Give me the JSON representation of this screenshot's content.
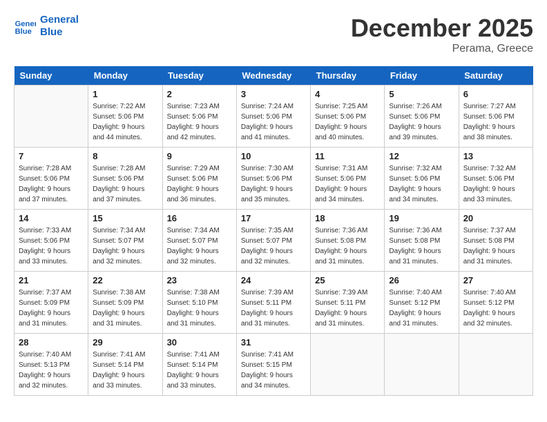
{
  "header": {
    "logo_line1": "General",
    "logo_line2": "Blue",
    "month": "December 2025",
    "location": "Perama, Greece"
  },
  "days_of_week": [
    "Sunday",
    "Monday",
    "Tuesday",
    "Wednesday",
    "Thursday",
    "Friday",
    "Saturday"
  ],
  "weeks": [
    [
      {
        "day": "",
        "info": ""
      },
      {
        "day": "1",
        "info": "Sunrise: 7:22 AM\nSunset: 5:06 PM\nDaylight: 9 hours\nand 44 minutes."
      },
      {
        "day": "2",
        "info": "Sunrise: 7:23 AM\nSunset: 5:06 PM\nDaylight: 9 hours\nand 42 minutes."
      },
      {
        "day": "3",
        "info": "Sunrise: 7:24 AM\nSunset: 5:06 PM\nDaylight: 9 hours\nand 41 minutes."
      },
      {
        "day": "4",
        "info": "Sunrise: 7:25 AM\nSunset: 5:06 PM\nDaylight: 9 hours\nand 40 minutes."
      },
      {
        "day": "5",
        "info": "Sunrise: 7:26 AM\nSunset: 5:06 PM\nDaylight: 9 hours\nand 39 minutes."
      },
      {
        "day": "6",
        "info": "Sunrise: 7:27 AM\nSunset: 5:06 PM\nDaylight: 9 hours\nand 38 minutes."
      }
    ],
    [
      {
        "day": "7",
        "info": "Sunrise: 7:28 AM\nSunset: 5:06 PM\nDaylight: 9 hours\nand 37 minutes."
      },
      {
        "day": "8",
        "info": "Sunrise: 7:28 AM\nSunset: 5:06 PM\nDaylight: 9 hours\nand 37 minutes."
      },
      {
        "day": "9",
        "info": "Sunrise: 7:29 AM\nSunset: 5:06 PM\nDaylight: 9 hours\nand 36 minutes."
      },
      {
        "day": "10",
        "info": "Sunrise: 7:30 AM\nSunset: 5:06 PM\nDaylight: 9 hours\nand 35 minutes."
      },
      {
        "day": "11",
        "info": "Sunrise: 7:31 AM\nSunset: 5:06 PM\nDaylight: 9 hours\nand 34 minutes."
      },
      {
        "day": "12",
        "info": "Sunrise: 7:32 AM\nSunset: 5:06 PM\nDaylight: 9 hours\nand 34 minutes."
      },
      {
        "day": "13",
        "info": "Sunrise: 7:32 AM\nSunset: 5:06 PM\nDaylight: 9 hours\nand 33 minutes."
      }
    ],
    [
      {
        "day": "14",
        "info": "Sunrise: 7:33 AM\nSunset: 5:06 PM\nDaylight: 9 hours\nand 33 minutes."
      },
      {
        "day": "15",
        "info": "Sunrise: 7:34 AM\nSunset: 5:07 PM\nDaylight: 9 hours\nand 32 minutes."
      },
      {
        "day": "16",
        "info": "Sunrise: 7:34 AM\nSunset: 5:07 PM\nDaylight: 9 hours\nand 32 minutes."
      },
      {
        "day": "17",
        "info": "Sunrise: 7:35 AM\nSunset: 5:07 PM\nDaylight: 9 hours\nand 32 minutes."
      },
      {
        "day": "18",
        "info": "Sunrise: 7:36 AM\nSunset: 5:08 PM\nDaylight: 9 hours\nand 31 minutes."
      },
      {
        "day": "19",
        "info": "Sunrise: 7:36 AM\nSunset: 5:08 PM\nDaylight: 9 hours\nand 31 minutes."
      },
      {
        "day": "20",
        "info": "Sunrise: 7:37 AM\nSunset: 5:08 PM\nDaylight: 9 hours\nand 31 minutes."
      }
    ],
    [
      {
        "day": "21",
        "info": "Sunrise: 7:37 AM\nSunset: 5:09 PM\nDaylight: 9 hours\nand 31 minutes."
      },
      {
        "day": "22",
        "info": "Sunrise: 7:38 AM\nSunset: 5:09 PM\nDaylight: 9 hours\nand 31 minutes."
      },
      {
        "day": "23",
        "info": "Sunrise: 7:38 AM\nSunset: 5:10 PM\nDaylight: 9 hours\nand 31 minutes."
      },
      {
        "day": "24",
        "info": "Sunrise: 7:39 AM\nSunset: 5:11 PM\nDaylight: 9 hours\nand 31 minutes."
      },
      {
        "day": "25",
        "info": "Sunrise: 7:39 AM\nSunset: 5:11 PM\nDaylight: 9 hours\nand 31 minutes."
      },
      {
        "day": "26",
        "info": "Sunrise: 7:40 AM\nSunset: 5:12 PM\nDaylight: 9 hours\nand 31 minutes."
      },
      {
        "day": "27",
        "info": "Sunrise: 7:40 AM\nSunset: 5:12 PM\nDaylight: 9 hours\nand 32 minutes."
      }
    ],
    [
      {
        "day": "28",
        "info": "Sunrise: 7:40 AM\nSunset: 5:13 PM\nDaylight: 9 hours\nand 32 minutes."
      },
      {
        "day": "29",
        "info": "Sunrise: 7:41 AM\nSunset: 5:14 PM\nDaylight: 9 hours\nand 33 minutes."
      },
      {
        "day": "30",
        "info": "Sunrise: 7:41 AM\nSunset: 5:14 PM\nDaylight: 9 hours\nand 33 minutes."
      },
      {
        "day": "31",
        "info": "Sunrise: 7:41 AM\nSunset: 5:15 PM\nDaylight: 9 hours\nand 34 minutes."
      },
      {
        "day": "",
        "info": ""
      },
      {
        "day": "",
        "info": ""
      },
      {
        "day": "",
        "info": ""
      }
    ]
  ]
}
